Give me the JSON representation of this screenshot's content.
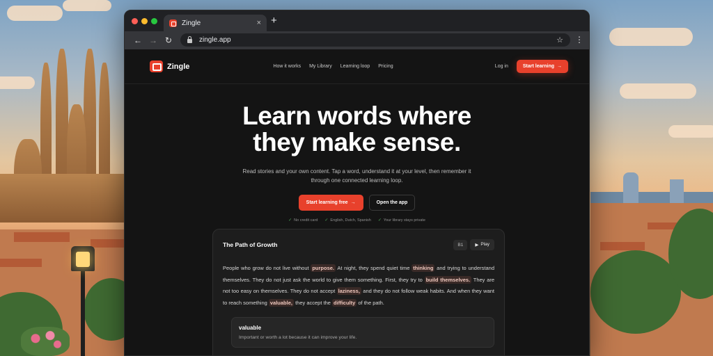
{
  "browser": {
    "tab_title": "Zingle",
    "tab_close": "×",
    "new_tab": "+",
    "url": "zingle.app"
  },
  "nav": {
    "brand": "Zingle",
    "links": [
      "How it works",
      "My Library",
      "Learning loop",
      "Pricing"
    ],
    "login": "Log in",
    "cta": "Start learning",
    "cta_arrow": "→"
  },
  "hero": {
    "title_line1": "Learn words where",
    "title_line2": "they make sense.",
    "subtitle": "Read stories and your own content. Tap a word, understand it at your level, then remember it through one connected learning loop.",
    "primary_button": "Start learning free",
    "primary_arrow": "→",
    "secondary_button": "Open the app",
    "perks": [
      "No credit card",
      "English, Dutch, Spanish",
      "Your library stays private"
    ]
  },
  "story_card": {
    "title": "The Path of Growth",
    "level": "B1",
    "play_label": "Play",
    "text": [
      {
        "t": "People who grow do not live without "
      },
      {
        "t": "purpose.",
        "hl": true
      },
      {
        "t": " At night, they spend quiet time "
      },
      {
        "t": "thinking",
        "hl": true
      },
      {
        "t": " and trying to understand themselves. They do not just ask the world to give them something. First, they try to "
      },
      {
        "t": "build themselves.",
        "hl": true
      },
      {
        "t": " They are not too easy on themselves. They do not accept "
      },
      {
        "t": "laziness,",
        "hl": true
      },
      {
        "t": " and they do not follow weak habits. And when they want to reach something "
      },
      {
        "t": "valuable,",
        "hl": true
      },
      {
        "t": " they accept the "
      },
      {
        "t": "difficulty",
        "hl": true
      },
      {
        "t": " of the path."
      }
    ],
    "definition": {
      "word": "valuable",
      "meaning": "Important or worth a lot because it can improve your life."
    }
  },
  "colors": {
    "accent": "#e8412c",
    "page_bg": "#141414",
    "card_bg": "#1d1d1d"
  }
}
